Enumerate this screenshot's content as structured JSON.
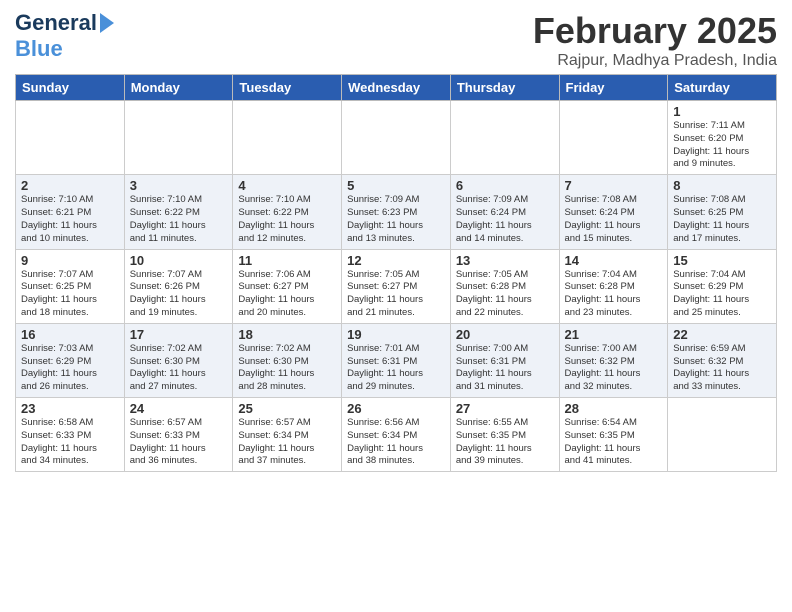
{
  "header": {
    "logo_general": "General",
    "logo_blue": "Blue",
    "month_year": "February 2025",
    "location": "Rajpur, Madhya Pradesh, India"
  },
  "weekdays": [
    "Sunday",
    "Monday",
    "Tuesday",
    "Wednesday",
    "Thursday",
    "Friday",
    "Saturday"
  ],
  "weeks": [
    [
      {
        "day": "",
        "info": ""
      },
      {
        "day": "",
        "info": ""
      },
      {
        "day": "",
        "info": ""
      },
      {
        "day": "",
        "info": ""
      },
      {
        "day": "",
        "info": ""
      },
      {
        "day": "",
        "info": ""
      },
      {
        "day": "1",
        "info": "Sunrise: 7:11 AM\nSunset: 6:20 PM\nDaylight: 11 hours\nand 9 minutes."
      }
    ],
    [
      {
        "day": "2",
        "info": "Sunrise: 7:10 AM\nSunset: 6:21 PM\nDaylight: 11 hours\nand 10 minutes."
      },
      {
        "day": "3",
        "info": "Sunrise: 7:10 AM\nSunset: 6:22 PM\nDaylight: 11 hours\nand 11 minutes."
      },
      {
        "day": "4",
        "info": "Sunrise: 7:10 AM\nSunset: 6:22 PM\nDaylight: 11 hours\nand 12 minutes."
      },
      {
        "day": "5",
        "info": "Sunrise: 7:09 AM\nSunset: 6:23 PM\nDaylight: 11 hours\nand 13 minutes."
      },
      {
        "day": "6",
        "info": "Sunrise: 7:09 AM\nSunset: 6:24 PM\nDaylight: 11 hours\nand 14 minutes."
      },
      {
        "day": "7",
        "info": "Sunrise: 7:08 AM\nSunset: 6:24 PM\nDaylight: 11 hours\nand 15 minutes."
      },
      {
        "day": "8",
        "info": "Sunrise: 7:08 AM\nSunset: 6:25 PM\nDaylight: 11 hours\nand 17 minutes."
      }
    ],
    [
      {
        "day": "9",
        "info": "Sunrise: 7:07 AM\nSunset: 6:25 PM\nDaylight: 11 hours\nand 18 minutes."
      },
      {
        "day": "10",
        "info": "Sunrise: 7:07 AM\nSunset: 6:26 PM\nDaylight: 11 hours\nand 19 minutes."
      },
      {
        "day": "11",
        "info": "Sunrise: 7:06 AM\nSunset: 6:27 PM\nDaylight: 11 hours\nand 20 minutes."
      },
      {
        "day": "12",
        "info": "Sunrise: 7:05 AM\nSunset: 6:27 PM\nDaylight: 11 hours\nand 21 minutes."
      },
      {
        "day": "13",
        "info": "Sunrise: 7:05 AM\nSunset: 6:28 PM\nDaylight: 11 hours\nand 22 minutes."
      },
      {
        "day": "14",
        "info": "Sunrise: 7:04 AM\nSunset: 6:28 PM\nDaylight: 11 hours\nand 23 minutes."
      },
      {
        "day": "15",
        "info": "Sunrise: 7:04 AM\nSunset: 6:29 PM\nDaylight: 11 hours\nand 25 minutes."
      }
    ],
    [
      {
        "day": "16",
        "info": "Sunrise: 7:03 AM\nSunset: 6:29 PM\nDaylight: 11 hours\nand 26 minutes."
      },
      {
        "day": "17",
        "info": "Sunrise: 7:02 AM\nSunset: 6:30 PM\nDaylight: 11 hours\nand 27 minutes."
      },
      {
        "day": "18",
        "info": "Sunrise: 7:02 AM\nSunset: 6:30 PM\nDaylight: 11 hours\nand 28 minutes."
      },
      {
        "day": "19",
        "info": "Sunrise: 7:01 AM\nSunset: 6:31 PM\nDaylight: 11 hours\nand 29 minutes."
      },
      {
        "day": "20",
        "info": "Sunrise: 7:00 AM\nSunset: 6:31 PM\nDaylight: 11 hours\nand 31 minutes."
      },
      {
        "day": "21",
        "info": "Sunrise: 7:00 AM\nSunset: 6:32 PM\nDaylight: 11 hours\nand 32 minutes."
      },
      {
        "day": "22",
        "info": "Sunrise: 6:59 AM\nSunset: 6:32 PM\nDaylight: 11 hours\nand 33 minutes."
      }
    ],
    [
      {
        "day": "23",
        "info": "Sunrise: 6:58 AM\nSunset: 6:33 PM\nDaylight: 11 hours\nand 34 minutes."
      },
      {
        "day": "24",
        "info": "Sunrise: 6:57 AM\nSunset: 6:33 PM\nDaylight: 11 hours\nand 36 minutes."
      },
      {
        "day": "25",
        "info": "Sunrise: 6:57 AM\nSunset: 6:34 PM\nDaylight: 11 hours\nand 37 minutes."
      },
      {
        "day": "26",
        "info": "Sunrise: 6:56 AM\nSunset: 6:34 PM\nDaylight: 11 hours\nand 38 minutes."
      },
      {
        "day": "27",
        "info": "Sunrise: 6:55 AM\nSunset: 6:35 PM\nDaylight: 11 hours\nand 39 minutes."
      },
      {
        "day": "28",
        "info": "Sunrise: 6:54 AM\nSunset: 6:35 PM\nDaylight: 11 hours\nand 41 minutes."
      },
      {
        "day": "",
        "info": ""
      }
    ]
  ]
}
